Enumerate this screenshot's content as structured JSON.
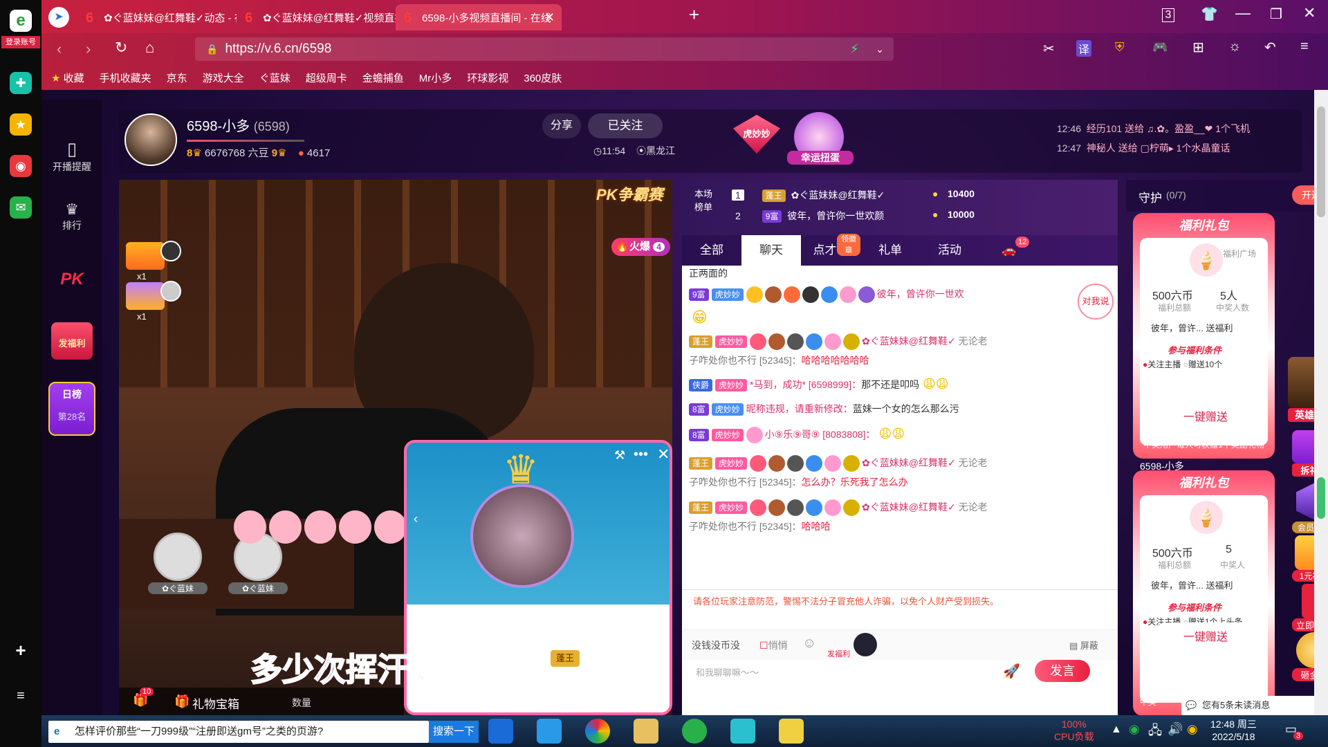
{
  "browser": {
    "login_label": "登录账号",
    "tabs": [
      {
        "title": "✿ぐ蓝妹妹@红舞鞋✓动态 - 在线"
      },
      {
        "title": "✿ぐ蓝妹妹@红舞鞋✓视频直播间"
      },
      {
        "title": "6598-小多视频直播间 - 在线"
      }
    ],
    "url": "https://v.6.cn/6598",
    "bookmarks": [
      "收藏",
      "手机收藏夹",
      "京东",
      "游戏大全",
      "ぐ蓝妹",
      "超级周卡",
      "金蟾捕鱼",
      "Mr小多",
      "环球影视",
      "360皮肤"
    ]
  },
  "sidebar": {
    "items": [
      {
        "label": "开播提醒"
      },
      {
        "label": "排行"
      },
      {
        "label": "PK"
      },
      {
        "label": "发福利"
      }
    ],
    "rank": {
      "title": "日榜",
      "place": "第28名"
    }
  },
  "anchor": {
    "name": "6598-小多",
    "id": "(6598)",
    "level_left": "8",
    "beans": "6676768 六豆",
    "level_right": "9",
    "fans": "4617",
    "share_label": "分享",
    "follow_label": "已关注",
    "time": "11:54",
    "location": "黑龙江",
    "badge1": "虎妙妙",
    "badge2": "幸运扭蛋",
    "gift_feed": [
      {
        "time": "12:46",
        "text": "经历101 送给 ♫.✿。盈盈__❤ 1个飞机"
      },
      {
        "time": "12:47",
        "text": "神秘人 送给 ▢柠萌▸ 1个水晶童话"
      }
    ]
  },
  "video": {
    "pk_label": "PK争霸赛",
    "hot_label": "火爆",
    "hot_count": "4",
    "seat_x1": "x1",
    "seat_x2": "x1",
    "seat_names": [
      "✿ぐ蓝妹",
      "✿ぐ蓝妹"
    ],
    "overlay_text": "多少次挥汗如雨",
    "mini_king": "蓬王",
    "bottom": {
      "gift_count": "10",
      "gift_label": "礼物宝箱",
      "qty_label": "数量"
    }
  },
  "chat": {
    "rank_label": "本场榜单",
    "rank": [
      {
        "pos": "1",
        "badge": "蓬王",
        "name": "✿ぐ蓝妹妹@红舞鞋✓",
        "score": "10400"
      },
      {
        "pos": "2",
        "badge": "9富",
        "name": "彼年，曾许你一世欢颜",
        "score": "10000"
      }
    ],
    "tabs": [
      {
        "label": "全部"
      },
      {
        "label": "聊天"
      },
      {
        "label": "点才艺"
      },
      {
        "label": "礼单"
      },
      {
        "label": "活动"
      }
    ],
    "tab_badge": "领徽章",
    "car_badge": "12",
    "top_text": "正两面的",
    "messages": [
      {
        "badge": "9富",
        "tag": "12",
        "tag_label": "虎妙妙",
        "user": "彼年，曾许你一世欢",
        "text": ""
      },
      {
        "badge": "蓬王",
        "tag": "54",
        "tag_label": "虎妙妙",
        "user": "✿ぐ蓝妹妹@红舞鞋✓",
        "extra": "无论老",
        "line2_user": "子咋处你也不行 [52345]：",
        "text": "哈哈哈哈哈哈哈"
      },
      {
        "badge": "侠爵",
        "tag": "43",
        "tag_label": "虎妙妙",
        "user": "*马到，成功* [6598999]：",
        "text": "那不还是叩吗"
      },
      {
        "badge": "8富",
        "tag": "7",
        "tag_label": "虎妙妙",
        "user": "昵称违规，请重新修改：",
        "text": "蓝妹一个女的怎么那么污"
      },
      {
        "badge": "8富",
        "tag": "32",
        "tag_label": "虎妙妙",
        "user": "小⑨乐⑨哥⑨ [8083808]：",
        "text": ""
      },
      {
        "badge": "蓬王",
        "tag": "54",
        "tag_label": "虎妙妙",
        "user": "✿ぐ蓝妹妹@红舞鞋✓",
        "extra": "无论老",
        "line2_user": "子咋处你也不行 [52345]：",
        "text": "怎么办？乐死我了怎么办"
      },
      {
        "badge": "蓬王",
        "tag": "54",
        "tag_label": "虎妙妙",
        "user": "✿ぐ蓝妹妹@红舞鞋✓",
        "extra": "无论老",
        "line2_user": "子咋处你也不行 [52345]：",
        "text": "哈哈哈"
      }
    ],
    "notice": "请各位玩家注意防范，警惕不法分子冒充他人诈骗，以免个人财产受到损失。",
    "input_hint": "没钱没币没",
    "quiet_label": "悄悄",
    "welfare_label": "发福利",
    "shield_label": "屏蔽",
    "chat_placeholder": "和我聊聊嘛～～",
    "send_label": "发言",
    "talk_btn": "对我说"
  },
  "guard": {
    "title": "守护",
    "count": "(0/7)",
    "open_label": "开通",
    "cards": [
      {
        "title": "福利礼包",
        "square": "福利广场",
        "amount": "500六币",
        "amount_label": "福利总额",
        "people": "5人",
        "people_label": "中奖人数",
        "giver": "彼年，曾许...",
        "send": "送福利",
        "cond": "参与福利条件",
        "c1": "关注主播",
        "c2": "赠送10个",
        "btn": "一键赠送",
        "foot": "中奖用户每人可获赠1个奖励礼物"
      },
      {
        "title": "福利礼包",
        "amount": "500六币",
        "amount_label": "福利总额",
        "people": "5",
        "people_label": "中奖人",
        "giver": "彼年，曾许...",
        "send": "送福利",
        "cond": "参与福利条件",
        "c1": "关注主播",
        "c2": "赠送1个上头条",
        "btn": "一键赠送",
        "foot": "中奖"
      }
    ],
    "side_btns": [
      "英雄无双",
      "拆礼包",
      "会员中心",
      "1元福利",
      "立即领取",
      "砸金蛋"
    ],
    "host_label": "6598-小多",
    "unread": "您有5条未读消息"
  },
  "taskbar": {
    "search_text": "怎样评价那些“一刀999级”“注册即送gm号”之类的页游?",
    "search_btn": "搜索一下",
    "cpu": "100%",
    "cpu_label": "CPU负载",
    "time": "12:48 周三",
    "date": "2022/5/18",
    "notif": "3"
  }
}
